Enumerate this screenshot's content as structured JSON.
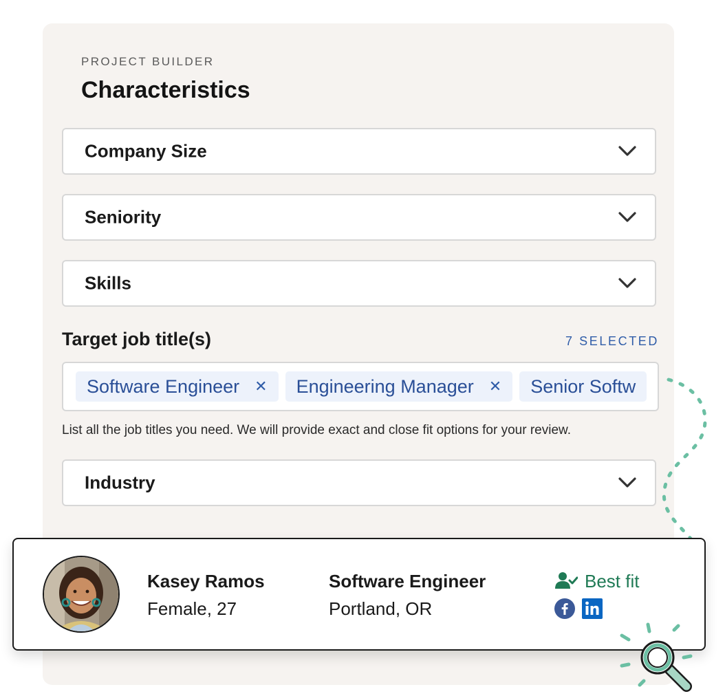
{
  "header": {
    "eyebrow": "PROJECT BUILDER",
    "title": "Characteristics"
  },
  "filters": [
    {
      "label": "Company Size"
    },
    {
      "label": "Seniority"
    },
    {
      "label": "Skills"
    }
  ],
  "job_titles": {
    "label": "Target job title(s)",
    "selected_count": "7 SELECTED",
    "tags": [
      "Software Engineer",
      "Engineering Manager",
      "Senior Softw"
    ],
    "helper": "List all the job titles you need. We will provide exact and close fit options for your review."
  },
  "industry": {
    "label": "Industry"
  },
  "candidate": {
    "name": "Kasey Ramos",
    "meta": "Female, 27",
    "title": "Software Engineer",
    "location": "Portland, OR",
    "fit": "Best fit",
    "fit_icon": "user-check-icon",
    "socials": [
      "facebook-icon",
      "linkedin-icon"
    ]
  },
  "colors": {
    "panel_bg": "#f6f3f0",
    "accent_blue": "#2f5ca8",
    "tag_bg": "#edf2fb",
    "fit_green": "#1f7a55",
    "deco_teal": "#6bbfa3"
  }
}
